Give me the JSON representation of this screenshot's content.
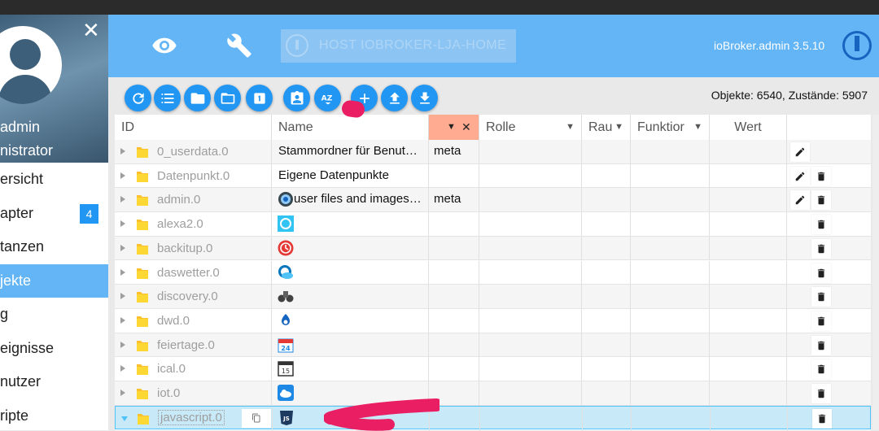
{
  "sidebar": {
    "user_name": "admin",
    "user_role": "nistrator",
    "items": [
      {
        "label": "ersicht",
        "badge": ""
      },
      {
        "label": "apter",
        "badge": "4"
      },
      {
        "label": "tanzen",
        "badge": ""
      },
      {
        "label": "jekte",
        "badge": "",
        "active": true
      },
      {
        "label": "g",
        "badge": ""
      },
      {
        "label": "eignisse",
        "badge": ""
      },
      {
        "label": "nutzer",
        "badge": ""
      },
      {
        "label": "ripte",
        "badge": ""
      }
    ]
  },
  "header": {
    "host": "HOST IOBROKER-LJA-HOME",
    "version": "ioBroker.admin 3.5.10"
  },
  "toolbar": {
    "buttons": [
      "refresh-icon",
      "list-icon",
      "folder-icon",
      "folder-outline-icon",
      "numeric-1-icon",
      "clipboard-account-icon",
      "sort-az-icon",
      "plus-icon",
      "upload-icon",
      "download-icon"
    ],
    "counts": "Objekte: 6540, Zustände: 5907"
  },
  "columns": {
    "id": "ID",
    "name": "Name",
    "type": "",
    "role": "Rolle",
    "room": "Rau",
    "function": "Funktior",
    "value": "Wert"
  },
  "rows": [
    {
      "id": "0_userdata.0",
      "name": "Stammordner für Benut…",
      "type": "meta",
      "icon": "",
      "edit": true,
      "delete": false
    },
    {
      "id": "Datenpunkt.0",
      "name": "Eigene Datenpunkte",
      "type": "",
      "icon": "",
      "edit": true,
      "delete": true
    },
    {
      "id": "admin.0",
      "name": "user files and images…",
      "type": "meta",
      "icon": "admin-icon",
      "edit": true,
      "delete": true
    },
    {
      "id": "alexa2.0",
      "name": "",
      "type": "",
      "icon": "alexa-icon",
      "edit": false,
      "delete": true
    },
    {
      "id": "backitup.0",
      "name": "",
      "type": "",
      "icon": "backitup-icon",
      "edit": false,
      "delete": true
    },
    {
      "id": "daswetter.0",
      "name": "",
      "type": "",
      "icon": "weather-icon",
      "edit": false,
      "delete": true
    },
    {
      "id": "discovery.0",
      "name": "",
      "type": "",
      "icon": "binoculars-icon",
      "edit": false,
      "delete": true
    },
    {
      "id": "dwd.0",
      "name": "",
      "type": "",
      "icon": "dwd-icon",
      "edit": false,
      "delete": true
    },
    {
      "id": "feiertage.0",
      "name": "",
      "type": "",
      "icon": "calendar-24-icon",
      "edit": false,
      "delete": true
    },
    {
      "id": "ical.0",
      "name": "",
      "type": "",
      "icon": "calendar-15-icon",
      "edit": false,
      "delete": true
    },
    {
      "id": "iot.0",
      "name": "",
      "type": "",
      "icon": "cloud-icon",
      "edit": false,
      "delete": true
    },
    {
      "id": "javascript.0",
      "name": "",
      "type": "",
      "icon": "javascript-icon",
      "edit": false,
      "delete": true,
      "selected": true
    }
  ],
  "colors": {
    "accent": "#2196f3",
    "header": "#64b5f6",
    "filter": "#ffab91",
    "annotation": "#e91e63"
  }
}
